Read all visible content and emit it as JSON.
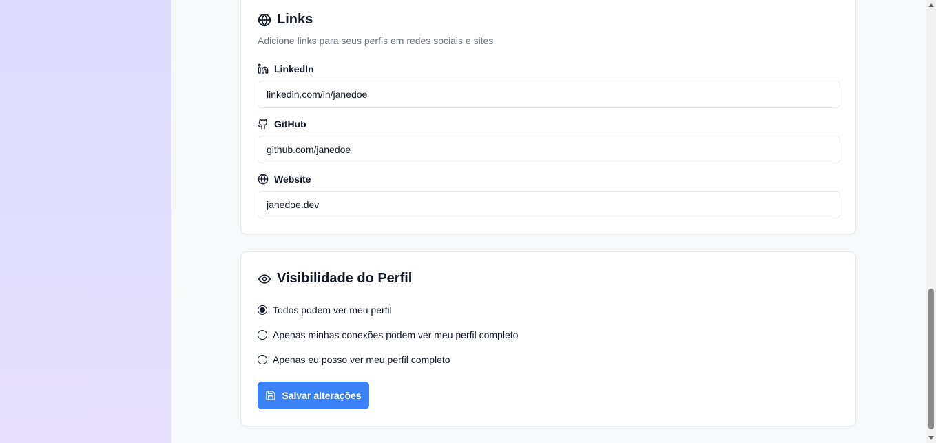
{
  "links_section": {
    "title": "Links",
    "subtitle": "Adicione links para seus perfis em redes sociais e sites",
    "title_icon": "globe-icon",
    "fields": [
      {
        "label": "LinkedIn",
        "icon": "linkedin-icon",
        "value": "linkedin.com/in/janedoe"
      },
      {
        "label": "GitHub",
        "icon": "github-icon",
        "value": "github.com/janedoe"
      },
      {
        "label": "Website",
        "icon": "globe-icon",
        "value": "janedoe.dev"
      }
    ]
  },
  "visibility_section": {
    "title": "Visibilidade do Perfil",
    "title_icon": "eye-icon",
    "options": [
      {
        "label": "Todos podem ver meu perfil",
        "selected": true
      },
      {
        "label": "Apenas minhas conexões podem ver meu perfil completo",
        "selected": false
      },
      {
        "label": "Apenas eu posso ver meu perfil completo",
        "selected": false
      }
    ],
    "save_label": "Salvar alterações",
    "save_icon": "save-icon"
  },
  "colors": {
    "accent": "#3b82f6",
    "left_panel": "#e0ddfd",
    "page_bg": "#f8f9fb",
    "card_border": "#e5e7eb",
    "muted_text": "#6b7280"
  }
}
